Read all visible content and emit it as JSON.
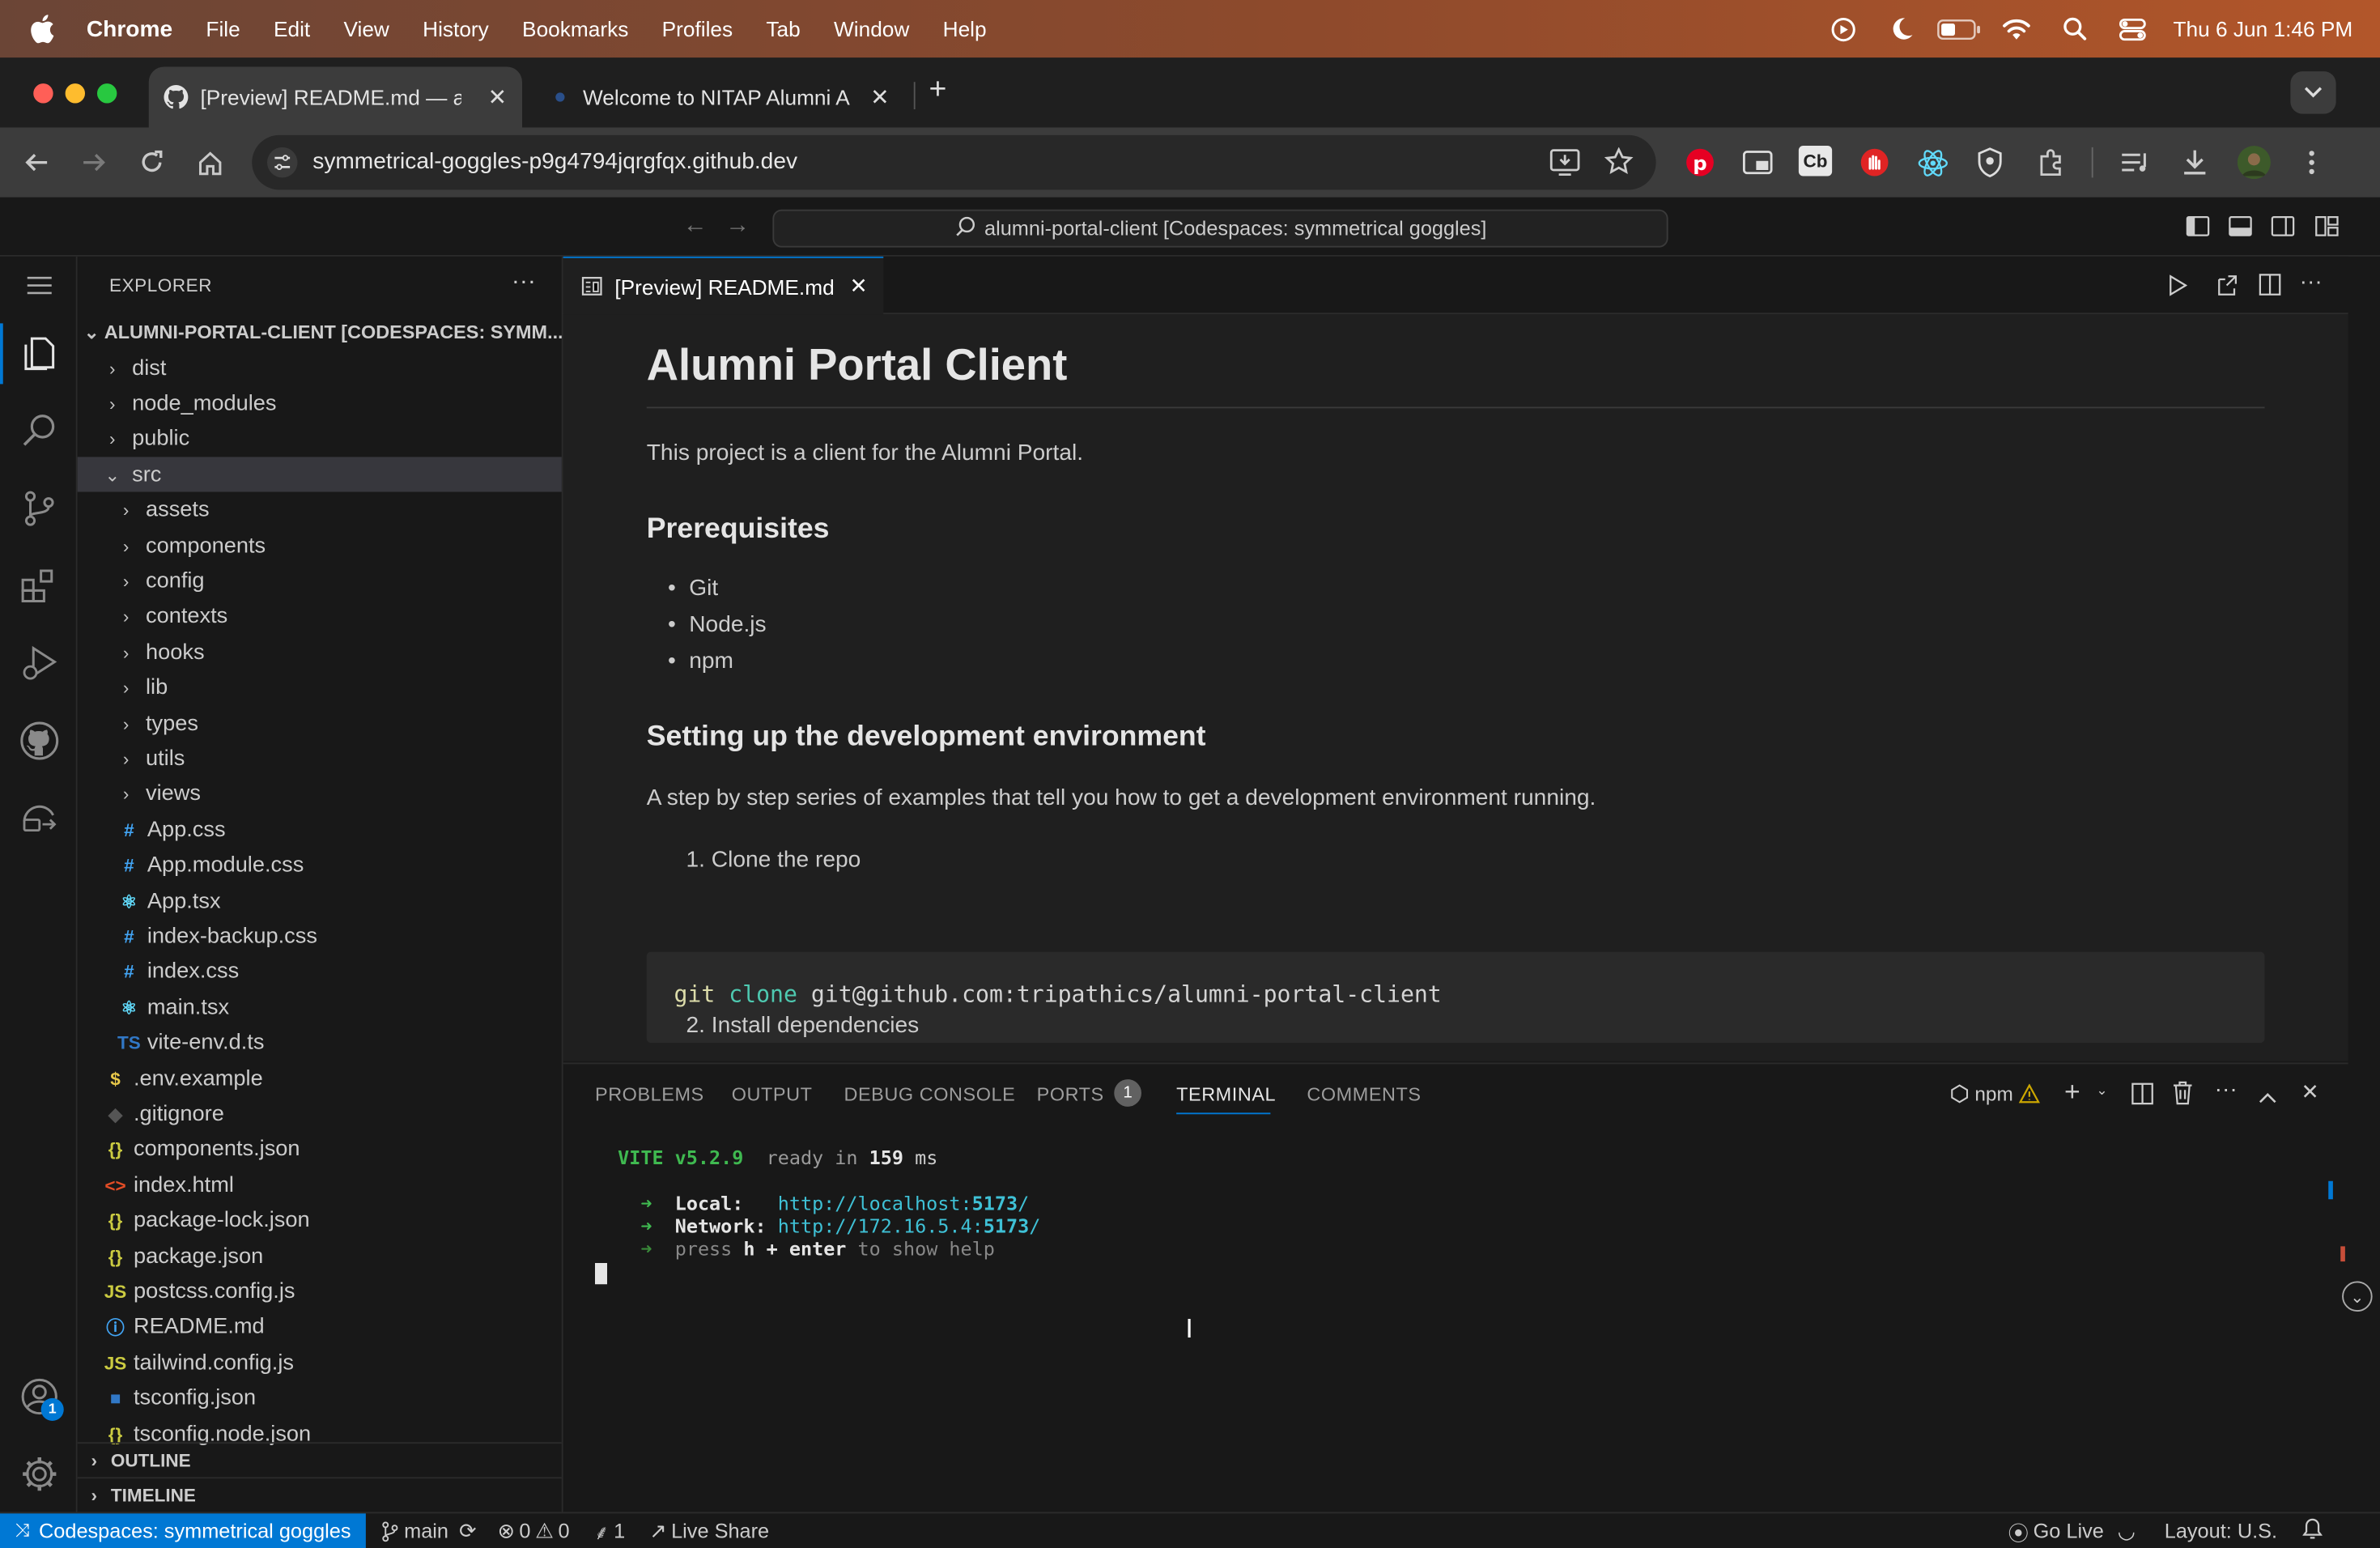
{
  "menubar": {
    "app": "Chrome",
    "items": [
      "File",
      "Edit",
      "View",
      "History",
      "Bookmarks",
      "Profiles",
      "Tab",
      "Window",
      "Help"
    ],
    "clock": "Thu 6 Jun  1:46 PM"
  },
  "chrome": {
    "tabs": [
      {
        "title": "[Preview] README.md — alumni-portal-client",
        "active": true
      },
      {
        "title": "Welcome to NITAP Alumni Association",
        "active": false
      }
    ],
    "url": "symmetrical-goggles-p9g4794jqrgfqx.github.dev",
    "extension_badge": "Cb"
  },
  "vscode": {
    "command_center": "alumni-portal-client [Codespaces: symmetrical goggles]",
    "explorer": {
      "title": "EXPLORER",
      "root": "ALUMNI-PORTAL-CLIENT [CODESPACES: SYMM...",
      "items": [
        {
          "name": "dist",
          "type": "folder",
          "depth": 1
        },
        {
          "name": "node_modules",
          "type": "folder",
          "depth": 1
        },
        {
          "name": "public",
          "type": "folder",
          "depth": 1
        },
        {
          "name": "src",
          "type": "folder-open",
          "depth": 1,
          "selected": true
        },
        {
          "name": "assets",
          "type": "folder",
          "depth": 2
        },
        {
          "name": "components",
          "type": "folder",
          "depth": 2
        },
        {
          "name": "config",
          "type": "folder",
          "depth": 2
        },
        {
          "name": "contexts",
          "type": "folder",
          "depth": 2
        },
        {
          "name": "hooks",
          "type": "folder",
          "depth": 2
        },
        {
          "name": "lib",
          "type": "folder",
          "depth": 2
        },
        {
          "name": "types",
          "type": "folder",
          "depth": 2
        },
        {
          "name": "utils",
          "type": "folder",
          "depth": 2
        },
        {
          "name": "views",
          "type": "folder",
          "depth": 2
        },
        {
          "name": "App.css",
          "type": "css",
          "depth": 2
        },
        {
          "name": "App.module.css",
          "type": "css",
          "depth": 2
        },
        {
          "name": "App.tsx",
          "type": "react",
          "depth": 2
        },
        {
          "name": "index-backup.css",
          "type": "css",
          "depth": 2
        },
        {
          "name": "index.css",
          "type": "css",
          "depth": 2
        },
        {
          "name": "main.tsx",
          "type": "react",
          "depth": 2
        },
        {
          "name": "vite-env.d.ts",
          "type": "ts",
          "depth": 2
        },
        {
          "name": ".env.example",
          "type": "env",
          "depth": 1
        },
        {
          "name": ".gitignore",
          "type": "git",
          "depth": 1
        },
        {
          "name": "components.json",
          "type": "json",
          "depth": 1
        },
        {
          "name": "index.html",
          "type": "html",
          "depth": 1
        },
        {
          "name": "package-lock.json",
          "type": "json",
          "depth": 1
        },
        {
          "name": "package.json",
          "type": "json",
          "depth": 1
        },
        {
          "name": "postcss.config.js",
          "type": "js",
          "depth": 1
        },
        {
          "name": "README.md",
          "type": "info",
          "depth": 1
        },
        {
          "name": "tailwind.config.js",
          "type": "js",
          "depth": 1
        },
        {
          "name": "tsconfig.json",
          "type": "tsconfig",
          "depth": 1
        },
        {
          "name": "tsconfig.node.json",
          "type": "json",
          "depth": 1
        }
      ],
      "outline": "OUTLINE",
      "timeline": "TIMELINE"
    },
    "editor_tab": "[Preview] README.md",
    "readme": {
      "h1": "Alumni Portal Client",
      "intro": "This project is a client for the Alumni Portal.",
      "h2_prereq": "Prerequisites",
      "prereqs": [
        "Git",
        "Node.js",
        "npm"
      ],
      "h2_setup": "Setting up the development environment",
      "setup_intro": "A step by step series of examples that tell you how to get a development environment running.",
      "step1": "1. Clone the repo",
      "code_cmd": "git",
      "code_kw": "clone",
      "code_arg": "git@github.com:tripathics/alumni-portal-client",
      "step2": "2. Install dependencies"
    },
    "panel": {
      "tabs": [
        "PROBLEMS",
        "OUTPUT",
        "DEBUG CONSOLE",
        "PORTS",
        "TERMINAL",
        "COMMENTS"
      ],
      "ports_badge": "1",
      "active": "TERMINAL",
      "terminal_label": "npm",
      "terminal": {
        "vite": "VITE v5.2.9",
        "ready": "ready in",
        "ms": "159",
        "ms_unit": "ms",
        "local_label": "Local:",
        "local_pre": "http://localhost:",
        "local_port": "5173",
        "network_label": "Network:",
        "network_pre": "http://172.16.5.4:",
        "network_port": "5173",
        "help_pre": "press",
        "help_key": "h + enter",
        "help_post": "to show help"
      }
    },
    "accounts_badge": "1",
    "status": {
      "remote": "Codespaces: symmetrical goggles",
      "branch": "main",
      "errors": "0",
      "warnings": "0",
      "ports": "1",
      "liveshare": "Live Share",
      "golive": "Go Live",
      "layout": "Layout: U.S."
    }
  },
  "colors": {
    "accent": "#0078d4",
    "menubar": "#8e4a2c",
    "terminal_green": "#3fb950",
    "link": "#3794ff"
  }
}
